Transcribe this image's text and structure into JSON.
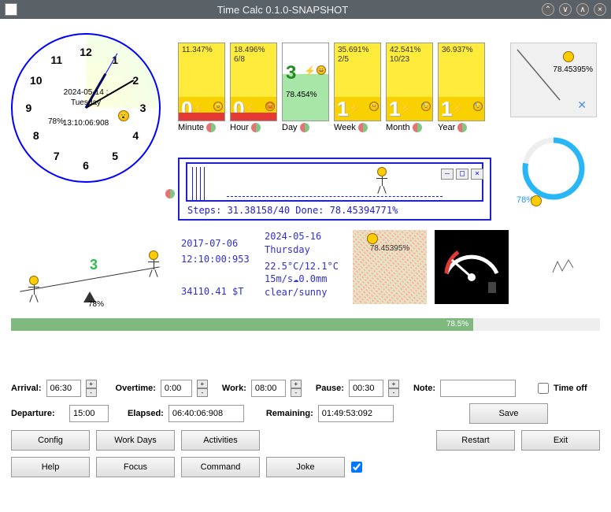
{
  "window": {
    "title": "Time Calc 0.1.0-SNAPSHOT"
  },
  "clock": {
    "date_line": "2024-05-14 : Tuesday",
    "time_line": "13:10:06:908",
    "percent": "78%"
  },
  "periods": [
    {
      "label": "Minute",
      "pct": "11.347%",
      "sub": "",
      "big": "0",
      "bg": "red"
    },
    {
      "label": "Hour",
      "pct": "18.496%",
      "sub": "6/8",
      "big": "0",
      "bg": "red"
    },
    {
      "label": "Day",
      "pct": "",
      "sub": "78.454%",
      "big": "3",
      "bg": "green",
      "green": true
    },
    {
      "label": "Week",
      "pct": "35.691%",
      "sub": "2/5",
      "big": "1",
      "bg": "yellow"
    },
    {
      "label": "Month",
      "pct": "42.541%",
      "sub": "10/23",
      "big": "1",
      "bg": "yellow"
    },
    {
      "label": "Year",
      "pct": "36.937%",
      "sub": "",
      "big": "1",
      "bg": "yellow"
    }
  ],
  "corner": {
    "pct": "78.45395%"
  },
  "arc": {
    "pct": "78%"
  },
  "steps": {
    "text": "Steps: 31.38158/40 Done: 78.45394771%"
  },
  "seesaw": {
    "num": "3",
    "pct": "78%"
  },
  "info1": {
    "date": "2017-07-06",
    "time": "12:10:00:953",
    "money": "34110.41 $T"
  },
  "info2": {
    "date": "2024-05-16",
    "day": "Thursday",
    "temp": "22.5°C/12.1°C",
    "wind": "15m/s☁0.0mm",
    "sky": "clear/sunny"
  },
  "noise": {
    "pct": "78.45395%"
  },
  "progress": {
    "pct": "78.5%",
    "width": "78.5%"
  },
  "form": {
    "arrival_lbl": "Arrival:",
    "arrival": "06:30",
    "overtime_lbl": "Overtime:",
    "overtime": "0:00",
    "work_lbl": "Work:",
    "work": "08:00",
    "pause_lbl": "Pause:",
    "pause": "00:30",
    "note_lbl": "Note:",
    "note": "",
    "timeoff_lbl": "Time off",
    "departure_lbl": "Departure:",
    "departure": "15:00",
    "elapsed_lbl": "Elapsed:",
    "elapsed": "06:40:06:908",
    "remaining_lbl": "Remaining:",
    "remaining": "01:49:53:092",
    "save": "Save"
  },
  "buttons": {
    "config": "Config",
    "workdays": "Work Days",
    "activities": "Activities",
    "restart": "Restart",
    "exit": "Exit",
    "help": "Help",
    "focus": "Focus",
    "command": "Command",
    "joke": "Joke"
  }
}
